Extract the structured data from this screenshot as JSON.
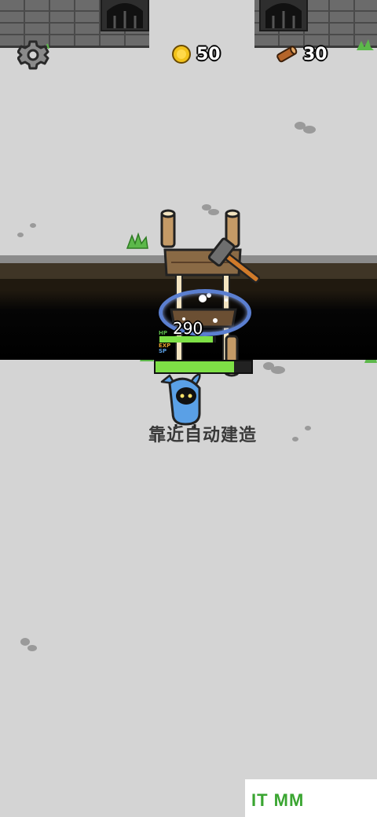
{
  "hud": {
    "settings_icon": "gear-icon",
    "coins": "50",
    "coin_icon": "coin-icon",
    "wood": "30",
    "wood_icon": "log-icon"
  },
  "build_site": {
    "hp_value": "290",
    "hp_label": "HP",
    "exp_label": "EXP",
    "sp_label": "SP",
    "hp_fraction": 0.95,
    "build_progress": 0.82
  },
  "hint": "靠近自动建造",
  "watermark": "IT MM",
  "colors": {
    "ground": "#d4d4d4",
    "wall": "#6b6b6b",
    "player": "#5aa0e6",
    "bar_green": "#7ee046",
    "ring_blue": "#5b7fd0"
  }
}
